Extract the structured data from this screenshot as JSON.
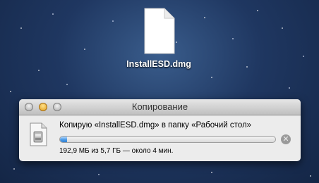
{
  "desktop": {
    "file_label": "InstallESD.dmg",
    "file_icon": "document-icon"
  },
  "dialog": {
    "title": "Копирование",
    "copy_text": "Копирую «InstallESD.dmg» в папку «Рабочий стол»",
    "status_text": "192,9 МБ из 5,7 ГБ — около 4 мин.",
    "progress": 0.033,
    "cancel_glyph": "✕",
    "file_icon": "disk-image-icon"
  }
}
